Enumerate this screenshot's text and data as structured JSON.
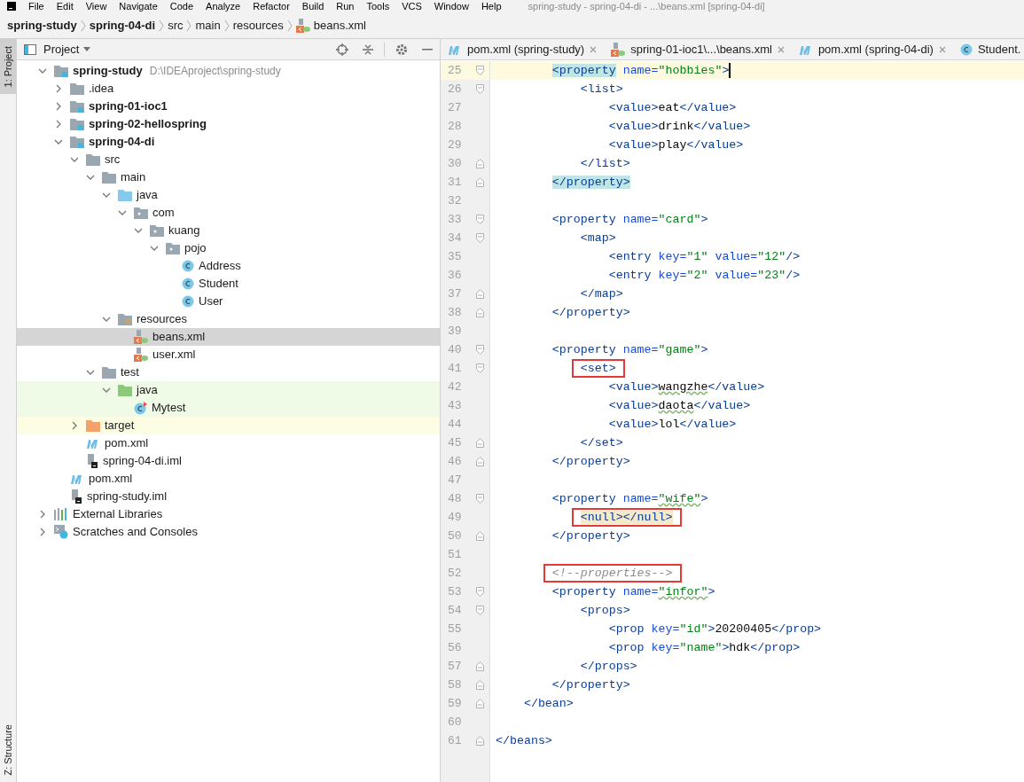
{
  "menu_bar": {
    "items": [
      "File",
      "Edit",
      "View",
      "Navigate",
      "Code",
      "Analyze",
      "Refactor",
      "Build",
      "Run",
      "Tools",
      "VCS",
      "Window",
      "Help"
    ],
    "title": "spring-study - spring-04-di - ...\\beans.xml [spring-04-di]"
  },
  "breadcrumbs": [
    {
      "label": "spring-study",
      "kind": "module"
    },
    {
      "label": "spring-04-di",
      "kind": "module"
    },
    {
      "label": "src",
      "kind": "plain"
    },
    {
      "label": "main",
      "kind": "plain"
    },
    {
      "label": "resources",
      "kind": "plain"
    },
    {
      "label": "beans.xml",
      "kind": "xml"
    }
  ],
  "side_tabs": [
    {
      "label": "1: Project",
      "selected": true
    },
    {
      "label": "Z: Structure",
      "selected": false
    }
  ],
  "project_panel": {
    "title": "Project",
    "tree": [
      {
        "name": "spring-study",
        "kind": "module",
        "path": "D:\\IDEAproject\\spring-study",
        "expanded": true,
        "selected": false,
        "children": [
          {
            "name": ".idea",
            "kind": "folder",
            "expanded": false,
            "selected": false
          },
          {
            "name": "spring-01-ioc1",
            "kind": "module",
            "expanded": false,
            "selected": false
          },
          {
            "name": "spring-02-hellospring",
            "kind": "module",
            "expanded": false,
            "selected": false
          },
          {
            "name": "spring-04-di",
            "kind": "module",
            "expanded": true,
            "selected": false,
            "children": [
              {
                "name": "src",
                "kind": "folder",
                "expanded": true,
                "selected": false,
                "children": [
                  {
                    "name": "main",
                    "kind": "folder",
                    "expanded": true,
                    "selected": false,
                    "children": [
                      {
                        "name": "java",
                        "kind": "source",
                        "expanded": true,
                        "selected": false,
                        "children": [
                          {
                            "name": "com",
                            "kind": "package",
                            "expanded": true,
                            "selected": false,
                            "children": [
                              {
                                "name": "kuang",
                                "kind": "package",
                                "expanded": true,
                                "selected": false,
                                "children": [
                                  {
                                    "name": "pojo",
                                    "kind": "package",
                                    "expanded": true,
                                    "selected": false,
                                    "children": [
                                      {
                                        "name": "Address",
                                        "kind": "class",
                                        "selected": false
                                      },
                                      {
                                        "name": "Student",
                                        "kind": "class",
                                        "selected": false
                                      },
                                      {
                                        "name": "User",
                                        "kind": "class",
                                        "selected": false
                                      }
                                    ]
                                  }
                                ]
                              }
                            ]
                          }
                        ]
                      },
                      {
                        "name": "resources",
                        "kind": "resources",
                        "expanded": true,
                        "selected": false,
                        "children": [
                          {
                            "name": "beans.xml",
                            "kind": "xml",
                            "selected": true
                          },
                          {
                            "name": "user.xml",
                            "kind": "xml",
                            "selected": false
                          }
                        ]
                      }
                    ]
                  },
                  {
                    "name": "test",
                    "kind": "folder",
                    "expanded": true,
                    "selected": false,
                    "children": [
                      {
                        "name": "java",
                        "kind": "test-source",
                        "expanded": true,
                        "selected": false,
                        "children": [
                          {
                            "name": "Mytest",
                            "kind": "test-class",
                            "selected": false
                          }
                        ]
                      }
                    ]
                  }
                ]
              },
              {
                "name": "target",
                "kind": "excluded",
                "expanded": false,
                "selected": false
              },
              {
                "name": "pom.xml",
                "kind": "maven",
                "selected": false
              },
              {
                "name": "spring-04-di.iml",
                "kind": "iml",
                "selected": false
              }
            ]
          },
          {
            "name": "pom.xml",
            "kind": "maven",
            "selected": false
          },
          {
            "name": "spring-study.iml",
            "kind": "iml",
            "selected": false
          }
        ]
      },
      {
        "name": "External Libraries",
        "kind": "libraries",
        "expanded": false,
        "selected": false
      },
      {
        "name": "Scratches and Consoles",
        "kind": "scratches",
        "expanded": false,
        "selected": false
      }
    ]
  },
  "editor_tabs": [
    {
      "label": "pom.xml (spring-study)",
      "kind": "maven",
      "closable": true,
      "selected": false
    },
    {
      "label": "spring-01-ioc1\\...\\beans.xml",
      "kind": "xml",
      "closable": true,
      "selected": false
    },
    {
      "label": "pom.xml (spring-04-di)",
      "kind": "maven",
      "closable": true,
      "selected": false
    },
    {
      "label": "Student.",
      "kind": "class",
      "closable": false,
      "selected": false
    }
  ],
  "code_lines": [
    {
      "number": "25",
      "fold_open": true,
      "fold_close": false,
      "current": true,
      "caret": true,
      "tokens": [
        {
          "kind": "tag",
          "text": "        <property",
          "matched": true
        },
        {
          "kind": "attr",
          "text": " name="
        },
        {
          "kind": "value",
          "text": "\"hobbies\""
        },
        {
          "kind": "tag",
          "text": ">"
        }
      ]
    },
    {
      "number": "26",
      "fold_open": true,
      "fold_close": false,
      "current": false,
      "caret": false,
      "tokens": [
        {
          "kind": "tag",
          "text": "            <list>"
        }
      ]
    },
    {
      "number": "27",
      "fold_open": false,
      "fold_close": false,
      "current": false,
      "caret": false,
      "tokens": [
        {
          "kind": "tag",
          "text": "                <value>"
        },
        {
          "kind": "text",
          "text": "eat"
        },
        {
          "kind": "tag",
          "text": "</value>"
        }
      ]
    },
    {
      "number": "28",
      "fold_open": false,
      "fold_close": false,
      "current": false,
      "caret": false,
      "tokens": [
        {
          "kind": "tag",
          "text": "                <value>"
        },
        {
          "kind": "text",
          "text": "drink"
        },
        {
          "kind": "tag",
          "text": "</value>"
        }
      ]
    },
    {
      "number": "29",
      "fold_open": false,
      "fold_close": false,
      "current": false,
      "caret": false,
      "tokens": [
        {
          "kind": "tag",
          "text": "                <value>"
        },
        {
          "kind": "text",
          "text": "play"
        },
        {
          "kind": "tag",
          "text": "</value>"
        }
      ]
    },
    {
      "number": "30",
      "fold_open": false,
      "fold_close": true,
      "current": false,
      "caret": false,
      "tokens": [
        {
          "kind": "tag",
          "text": "            </list>"
        }
      ]
    },
    {
      "number": "31",
      "fold_open": false,
      "fold_close": true,
      "current": false,
      "caret": false,
      "tokens": [
        {
          "kind": "tag",
          "text": "        </property>",
          "matched": true
        }
      ]
    },
    {
      "number": "32",
      "fold_open": false,
      "fold_close": false,
      "current": false,
      "caret": false
    },
    {
      "number": "33",
      "fold_open": true,
      "fold_close": false,
      "current": false,
      "caret": false,
      "tokens": [
        {
          "kind": "tag",
          "text": "        <property"
        },
        {
          "kind": "attr",
          "text": " name="
        },
        {
          "kind": "value",
          "text": "\"card\""
        },
        {
          "kind": "tag",
          "text": ">"
        }
      ]
    },
    {
      "number": "34",
      "fold_open": true,
      "fold_close": false,
      "current": false,
      "caret": false,
      "tokens": [
        {
          "kind": "tag",
          "text": "            <map>"
        }
      ]
    },
    {
      "number": "35",
      "fold_open": false,
      "fold_close": false,
      "current": false,
      "caret": false,
      "tokens": [
        {
          "kind": "tag",
          "text": "                <entry"
        },
        {
          "kind": "attr",
          "text": " key="
        },
        {
          "kind": "value",
          "text": "\"1\""
        },
        {
          "kind": "attr",
          "text": " value="
        },
        {
          "kind": "value",
          "text": "\"12\""
        },
        {
          "kind": "tag",
          "text": "/>"
        }
      ]
    },
    {
      "number": "36",
      "fold_open": false,
      "fold_close": false,
      "current": false,
      "caret": false,
      "tokens": [
        {
          "kind": "tag",
          "text": "                <entry"
        },
        {
          "kind": "attr",
          "text": " key="
        },
        {
          "kind": "value",
          "text": "\"2\""
        },
        {
          "kind": "attr",
          "text": " value="
        },
        {
          "kind": "value",
          "text": "\"23\""
        },
        {
          "kind": "tag",
          "text": "/>"
        }
      ]
    },
    {
      "number": "37",
      "fold_open": false,
      "fold_close": true,
      "current": false,
      "caret": false,
      "tokens": [
        {
          "kind": "tag",
          "text": "            </map>"
        }
      ]
    },
    {
      "number": "38",
      "fold_open": false,
      "fold_close": true,
      "current": false,
      "caret": false,
      "tokens": [
        {
          "kind": "tag",
          "text": "        </property>"
        }
      ]
    },
    {
      "number": "39",
      "fold_open": false,
      "fold_close": false,
      "current": false,
      "caret": false
    },
    {
      "number": "40",
      "fold_open": true,
      "fold_close": false,
      "current": false,
      "caret": false,
      "tokens": [
        {
          "kind": "tag",
          "text": "        <property"
        },
        {
          "kind": "attr",
          "text": " name="
        },
        {
          "kind": "value",
          "text": "\"game\""
        },
        {
          "kind": "tag",
          "text": ">"
        }
      ]
    },
    {
      "number": "41",
      "fold_open": true,
      "fold_close": false,
      "current": false,
      "caret": false,
      "tokens": [
        {
          "kind": "tag",
          "text": "            <set>",
          "boxed": true
        }
      ]
    },
    {
      "number": "42",
      "fold_open": false,
      "fold_close": false,
      "current": false,
      "caret": false,
      "tokens": [
        {
          "kind": "tag",
          "text": "                <value>"
        },
        {
          "kind": "text",
          "text": "wangzhe",
          "typo": true
        },
        {
          "kind": "tag",
          "text": "</value>"
        }
      ]
    },
    {
      "number": "43",
      "fold_open": false,
      "fold_close": false,
      "current": false,
      "caret": false,
      "tokens": [
        {
          "kind": "tag",
          "text": "                <value>"
        },
        {
          "kind": "text",
          "text": "daota",
          "typo": true
        },
        {
          "kind": "tag",
          "text": "</value>"
        }
      ]
    },
    {
      "number": "44",
      "fold_open": false,
      "fold_close": false,
      "current": false,
      "caret": false,
      "tokens": [
        {
          "kind": "tag",
          "text": "                <value>"
        },
        {
          "kind": "text",
          "text": "lol"
        },
        {
          "kind": "tag",
          "text": "</value>"
        }
      ]
    },
    {
      "number": "45",
      "fold_open": false,
      "fold_close": true,
      "current": false,
      "caret": false,
      "tokens": [
        {
          "kind": "tag",
          "text": "            </set>"
        }
      ]
    },
    {
      "number": "46",
      "fold_open": false,
      "fold_close": true,
      "current": false,
      "caret": false,
      "tokens": [
        {
          "kind": "tag",
          "text": "        </property>"
        }
      ]
    },
    {
      "number": "47",
      "fold_open": false,
      "fold_close": false,
      "current": false,
      "caret": false
    },
    {
      "number": "48",
      "fold_open": true,
      "fold_close": false,
      "current": false,
      "caret": false,
      "tokens": [
        {
          "kind": "tag",
          "text": "        <property"
        },
        {
          "kind": "attr",
          "text": " name="
        },
        {
          "kind": "value",
          "text": "\"wife\"",
          "typo": true
        },
        {
          "kind": "tag",
          "text": ">"
        }
      ]
    },
    {
      "number": "49",
      "fold_open": false,
      "fold_close": false,
      "current": false,
      "caret": false,
      "tokens": [
        {
          "kind": "tag",
          "text": "            <null></null>",
          "marked": true,
          "boxed": true
        }
      ]
    },
    {
      "number": "50",
      "fold_open": false,
      "fold_close": true,
      "current": false,
      "caret": false,
      "tokens": [
        {
          "kind": "tag",
          "text": "        </property>"
        }
      ]
    },
    {
      "number": "51",
      "fold_open": false,
      "fold_close": false,
      "current": false,
      "caret": false
    },
    {
      "number": "52",
      "fold_open": false,
      "fold_close": false,
      "current": false,
      "caret": false,
      "tokens": [
        {
          "kind": "comment",
          "text": "        <!--properties-->",
          "boxed": true
        }
      ]
    },
    {
      "number": "53",
      "fold_open": true,
      "fold_close": false,
      "current": false,
      "caret": false,
      "tokens": [
        {
          "kind": "tag",
          "text": "        <property"
        },
        {
          "kind": "attr",
          "text": " name="
        },
        {
          "kind": "value",
          "text": "\"infor\"",
          "typo": true
        },
        {
          "kind": "tag",
          "text": ">"
        }
      ]
    },
    {
      "number": "54",
      "fold_open": true,
      "fold_close": false,
      "current": false,
      "caret": false,
      "tokens": [
        {
          "kind": "tag",
          "text": "            <props>"
        }
      ]
    },
    {
      "number": "55",
      "fold_open": false,
      "fold_close": false,
      "current": false,
      "caret": false,
      "tokens": [
        {
          "kind": "tag",
          "text": "                <prop"
        },
        {
          "kind": "attr",
          "text": " key="
        },
        {
          "kind": "value",
          "text": "\"id\""
        },
        {
          "kind": "tag",
          "text": ">"
        },
        {
          "kind": "text",
          "text": "20200405"
        },
        {
          "kind": "tag",
          "text": "</prop>"
        }
      ]
    },
    {
      "number": "56",
      "fold_open": false,
      "fold_close": false,
      "current": false,
      "caret": false,
      "tokens": [
        {
          "kind": "tag",
          "text": "                <prop"
        },
        {
          "kind": "attr",
          "text": " key="
        },
        {
          "kind": "value",
          "text": "\"name\""
        },
        {
          "kind": "tag",
          "text": ">"
        },
        {
          "kind": "text",
          "text": "hdk"
        },
        {
          "kind": "tag",
          "text": "</prop>"
        }
      ]
    },
    {
      "number": "57",
      "fold_open": false,
      "fold_close": true,
      "current": false,
      "caret": false,
      "tokens": [
        {
          "kind": "tag",
          "text": "            </props>"
        }
      ]
    },
    {
      "number": "58",
      "fold_open": false,
      "fold_close": true,
      "current": false,
      "caret": false,
      "tokens": [
        {
          "kind": "tag",
          "text": "        </property>"
        }
      ]
    },
    {
      "number": "59",
      "fold_open": false,
      "fold_close": true,
      "current": false,
      "caret": false,
      "tokens": [
        {
          "kind": "tag",
          "text": "    </bean>"
        }
      ]
    },
    {
      "number": "60",
      "fold_open": false,
      "fold_close": false,
      "current": false,
      "caret": false
    },
    {
      "number": "61",
      "fold_open": false,
      "fold_close": true,
      "current": false,
      "caret": false,
      "tokens": [
        {
          "kind": "tag",
          "text": "</beans>"
        }
      ]
    }
  ]
}
